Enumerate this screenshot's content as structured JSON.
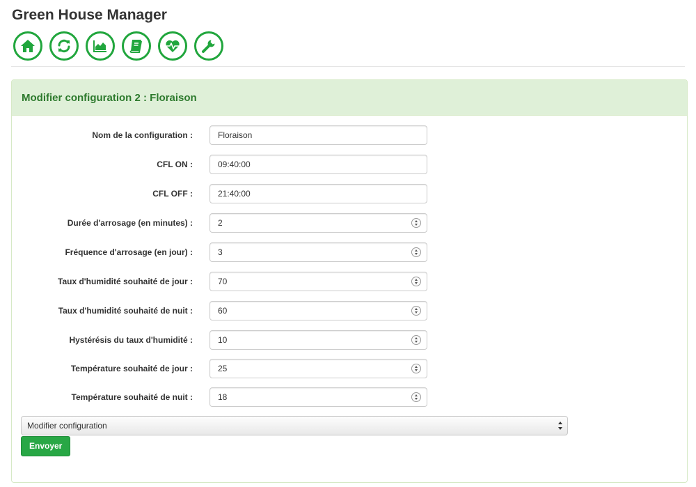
{
  "app": {
    "title": "Green House Manager"
  },
  "toolbar": {
    "accent_color": "#21a63d",
    "items": [
      {
        "icon": "home-icon"
      },
      {
        "icon": "refresh-icon"
      },
      {
        "icon": "chart-icon"
      },
      {
        "icon": "book-icon"
      },
      {
        "icon": "heartbeat-icon"
      },
      {
        "icon": "wrench-icon"
      }
    ]
  },
  "panel": {
    "title": "Modifier configuration 2 : Floraison",
    "heading_color": "#dff0d8"
  },
  "form": {
    "fields": [
      {
        "label": "Nom de la configuration :",
        "value": "Floraison"
      },
      {
        "label": "CFL ON :",
        "value": "09:40:00"
      },
      {
        "label": "CFL OFF :",
        "value": "21:40:00"
      },
      {
        "label": "Durée d'arrosage (en minutes) :",
        "value": "2"
      },
      {
        "label": "Fréquence d'arrosage (en jour) :",
        "value": "3"
      },
      {
        "label": "Taux d'humidité souhaité de jour :",
        "value": "70"
      },
      {
        "label": "Taux d'humidité souhaité de nuit :",
        "value": "60"
      },
      {
        "label": "Hystérésis du taux d'humidité :",
        "value": "10"
      },
      {
        "label": "Température souhaité de jour :",
        "value": "25"
      },
      {
        "label": "Température souhaité de nuit :",
        "value": "18"
      }
    ],
    "action_select": "Modifier configuration",
    "submit_label": "Envoyer",
    "submit_color": "#28a745"
  }
}
